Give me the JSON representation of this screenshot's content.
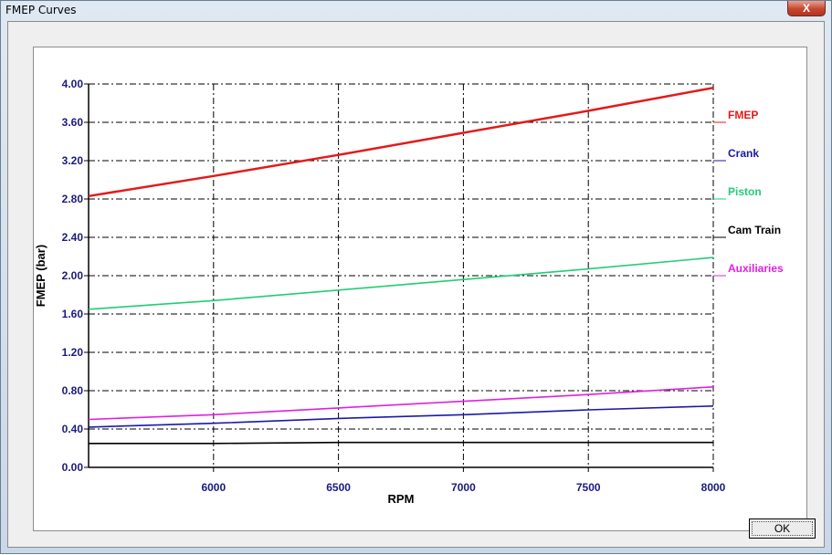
{
  "window": {
    "title": "FMEP Curves",
    "close_label": "X"
  },
  "buttons": {
    "ok_label": "OK"
  },
  "chart_data": {
    "type": "line",
    "xlabel": "RPM",
    "ylabel": "FMEP (bar)",
    "xlim": [
      5500,
      8000
    ],
    "ylim": [
      0,
      4.0
    ],
    "x_ticks": [
      "6000",
      "6500",
      "7000",
      "7500",
      "8000"
    ],
    "y_ticks": [
      "0.00",
      "0.40",
      "0.80",
      "1.20",
      "1.60",
      "2.00",
      "2.40",
      "2.80",
      "3.20",
      "3.60",
      "4.00"
    ],
    "grid": true,
    "legend_position": "right",
    "x": [
      5500,
      6000,
      6500,
      7000,
      7500,
      8000
    ],
    "series": [
      {
        "name": "FMEP",
        "color": "#e31a1a",
        "values": [
          2.83,
          3.04,
          3.26,
          3.49,
          3.72,
          3.96
        ]
      },
      {
        "name": "Crank",
        "color": "#1a1aa6",
        "values": [
          0.42,
          0.46,
          0.51,
          0.55,
          0.6,
          0.64
        ]
      },
      {
        "name": "Piston",
        "color": "#22cc77",
        "values": [
          1.65,
          1.74,
          1.85,
          1.96,
          2.07,
          2.19
        ]
      },
      {
        "name": "Cam Train",
        "color": "#000000",
        "values": [
          0.25,
          0.25,
          0.26,
          0.26,
          0.26,
          0.26
        ]
      },
      {
        "name": "Auxiliaries",
        "color": "#e020e0",
        "values": [
          0.5,
          0.55,
          0.62,
          0.69,
          0.76,
          0.84
        ]
      }
    ]
  }
}
